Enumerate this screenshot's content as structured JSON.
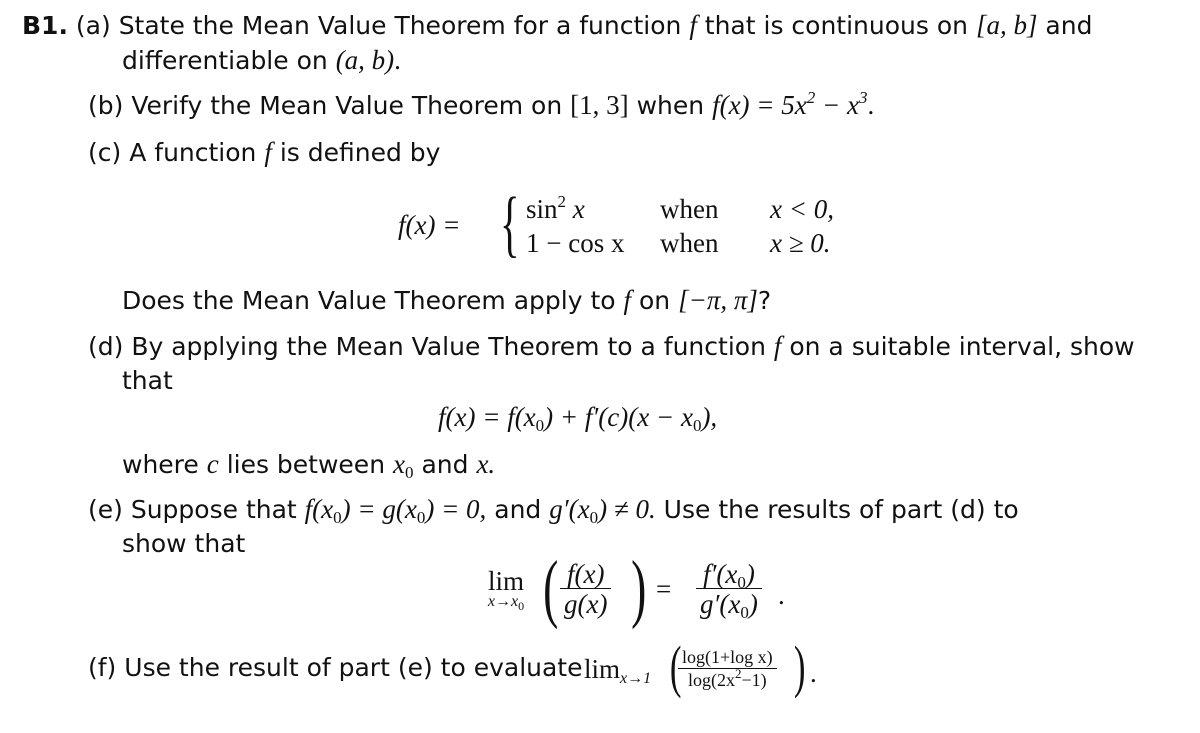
{
  "question_label": "B1.",
  "parts": {
    "a": {
      "label": "(a)",
      "text_1": "State the Mean Value Theorem for a function",
      "var_f": "f",
      "text_2": "that is continuous on",
      "interval_closed": "[a, b]",
      "text_3": "and",
      "text_4": "differentiable on",
      "interval_open": "(a, b)",
      "end": "."
    },
    "b": {
      "label": "(b)",
      "text_1": "Verify the Mean Value Theorem on",
      "interval": "[1, 3]",
      "text_2": "when",
      "function": "f(x) = 5x",
      "exp1": "2",
      "minus": " − x",
      "exp2": "3",
      "end": "."
    },
    "c": {
      "label": "(c)",
      "text_1": "A function",
      "var_f": "f",
      "text_2": "is defined by",
      "piecewise_lhs": "f(x) =",
      "cases": [
        {
          "expr_pre": "sin",
          "expr_exp": "2",
          "expr_post": " x",
          "cond_word": "when",
          "cond": "x < 0,"
        },
        {
          "expr_pre": "1 − cos x",
          "expr_exp": "",
          "expr_post": "",
          "cond_word": "when",
          "cond": "x ≥ 0."
        }
      ],
      "question_1": "Does the Mean Value Theorem apply to",
      "question_f": "f",
      "question_2": "on",
      "question_interval": "[−π, π]",
      "question_end": "?"
    },
    "d": {
      "label": "(d)",
      "text_1": "By applying the Mean Value Theorem to a function",
      "var_f": "f",
      "text_2": "on a suitable interval, show",
      "text_3": "that",
      "equation": "f(x) = f(x",
      "eq_sub1": "0",
      "eq_mid": ") + f′(c)(x − x",
      "eq_sub2": "0",
      "eq_end": "),",
      "where_1": "where",
      "where_c": "c",
      "where_2": "lies between",
      "where_x0": "x",
      "where_x0_sub": "0",
      "where_3": "and",
      "where_x": "x."
    },
    "e": {
      "label": "(e)",
      "text_1": "Suppose that",
      "cond": "f(x",
      "cond_sub1": "0",
      "cond_mid": ") = g(x",
      "cond_sub2": "0",
      "cond_end": ") = 0,",
      "text_2": "and",
      "cond2": "g′(x",
      "cond2_sub": "0",
      "cond2_end": ") ≠ 0.",
      "text_3": "Use the results of part (d) to",
      "text_4": "show that",
      "lim": "lim",
      "lim_sub": "x→x",
      "lim_sub0": "0",
      "lhs_num": "f(x)",
      "lhs_den": "g(x)",
      "eq": "=",
      "rhs_num": "f′(x",
      "rhs_num_sub": "0",
      "rhs_num_end": ")",
      "rhs_den": "g′(x",
      "rhs_den_sub": "0",
      "rhs_den_end": ")",
      "end": "."
    },
    "f": {
      "label": "(f)",
      "text_1": "Use the result of part (e) to evaluate",
      "lim": "lim",
      "lim_sub": "x→1",
      "num": "log(1+log x)",
      "den_pre": "log(2x",
      "den_exp": "2",
      "den_post": "−1)",
      "end": "."
    }
  }
}
